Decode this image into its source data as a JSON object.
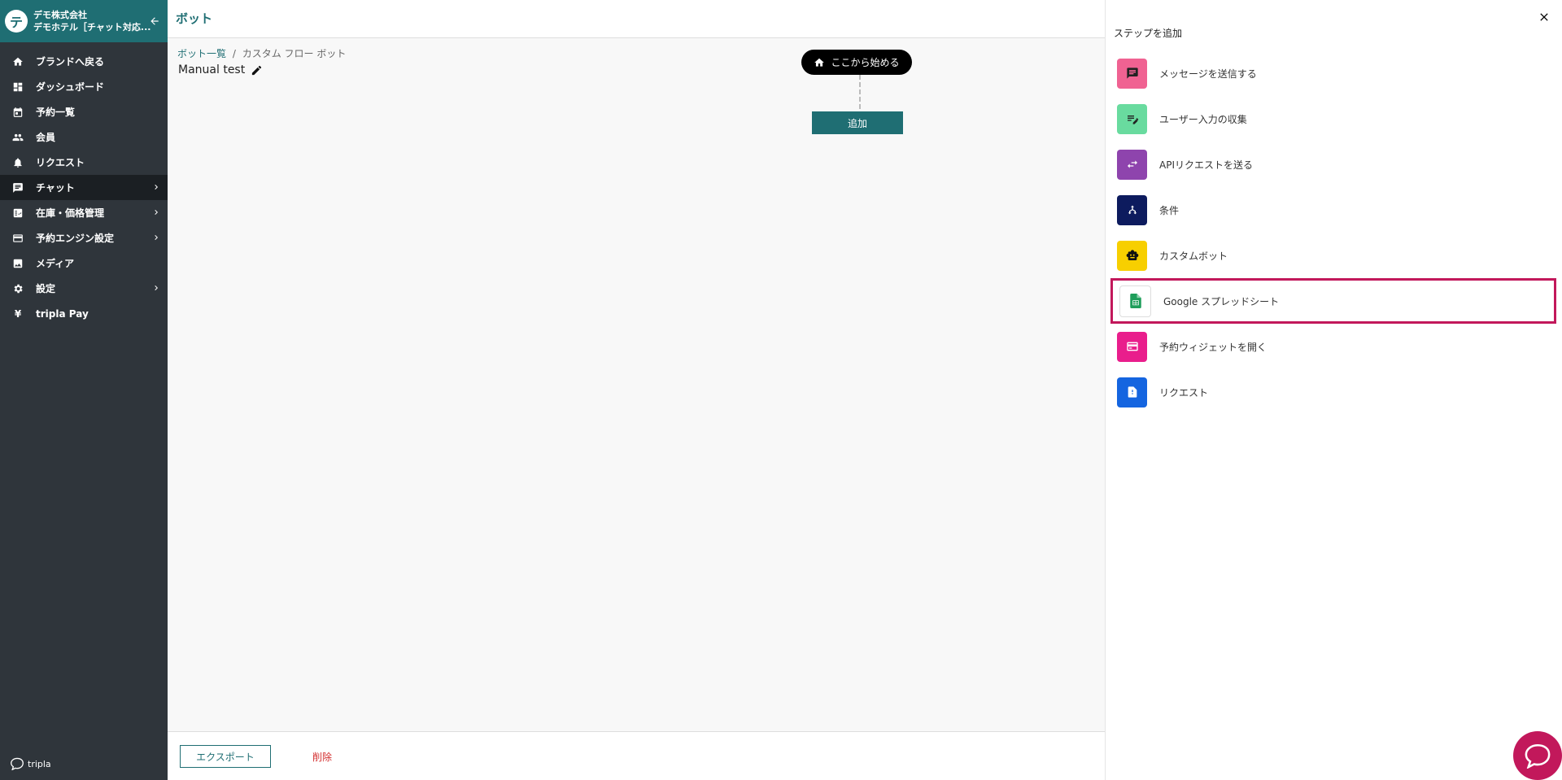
{
  "sidebar": {
    "company": "デモ株式会社",
    "hotel": "デモホテル［チャット対応...",
    "logo_glyph": "テ",
    "items": [
      {
        "label": "ブランドへ戻る",
        "icon": "home-icon"
      },
      {
        "label": "ダッシュボード",
        "icon": "dashboard-icon"
      },
      {
        "label": "予約一覧",
        "icon": "calendar-icon"
      },
      {
        "label": "会員",
        "icon": "people-icon"
      },
      {
        "label": "リクエスト",
        "icon": "bell-icon"
      },
      {
        "label": "チャット",
        "icon": "chat-icon",
        "active": true,
        "chevron": true
      },
      {
        "label": "在庫・価格管理",
        "icon": "inventory-icon",
        "chevron": true
      },
      {
        "label": "予約エンジン設定",
        "icon": "engine-icon",
        "chevron": true
      },
      {
        "label": "メディア",
        "icon": "media-icon"
      },
      {
        "label": "設定",
        "icon": "gear-icon",
        "chevron": true
      },
      {
        "label": "tripla Pay",
        "icon": "yen-icon"
      }
    ],
    "footer_brand": "tripla"
  },
  "header": {
    "title": "ボット"
  },
  "canvas": {
    "breadcrumb_link": "ボット一覧",
    "breadcrumb_sep": "/",
    "breadcrumb_current": "カスタム フロー ボット",
    "flow_name": "Manual test",
    "start_label": "ここから始める",
    "add_label": "追加"
  },
  "footer": {
    "export_label": "エクスポート",
    "delete_label": "削除"
  },
  "panel": {
    "title": "ステップを追加",
    "steps": [
      {
        "label": "メッセージを送信する",
        "icon": "message-icon",
        "color": "#f06292"
      },
      {
        "label": "ユーザー入力の収集",
        "icon": "edit-list-icon",
        "color": "#69db9f"
      },
      {
        "label": "APIリクエストを送る",
        "icon": "swap-icon",
        "color": "#8e44ad"
      },
      {
        "label": "条件",
        "icon": "branch-icon",
        "color": "#0d1b5e"
      },
      {
        "label": "カスタムボット",
        "icon": "robot-icon",
        "color": "#f7cf00"
      },
      {
        "label": "Google スプレッドシート",
        "icon": "sheets-icon",
        "color": "#ffffff"
      },
      {
        "label": "予約ウィジェットを開く",
        "icon": "widget-icon",
        "color": "#e91e8c"
      },
      {
        "label": "リクエスト",
        "icon": "request-doc-icon",
        "color": "#1565e0"
      }
    ]
  },
  "colors": {
    "brand": "#1f6e73",
    "sidebar": "#2f353b",
    "highlight": "#c2185b",
    "danger": "#d32f2f"
  }
}
